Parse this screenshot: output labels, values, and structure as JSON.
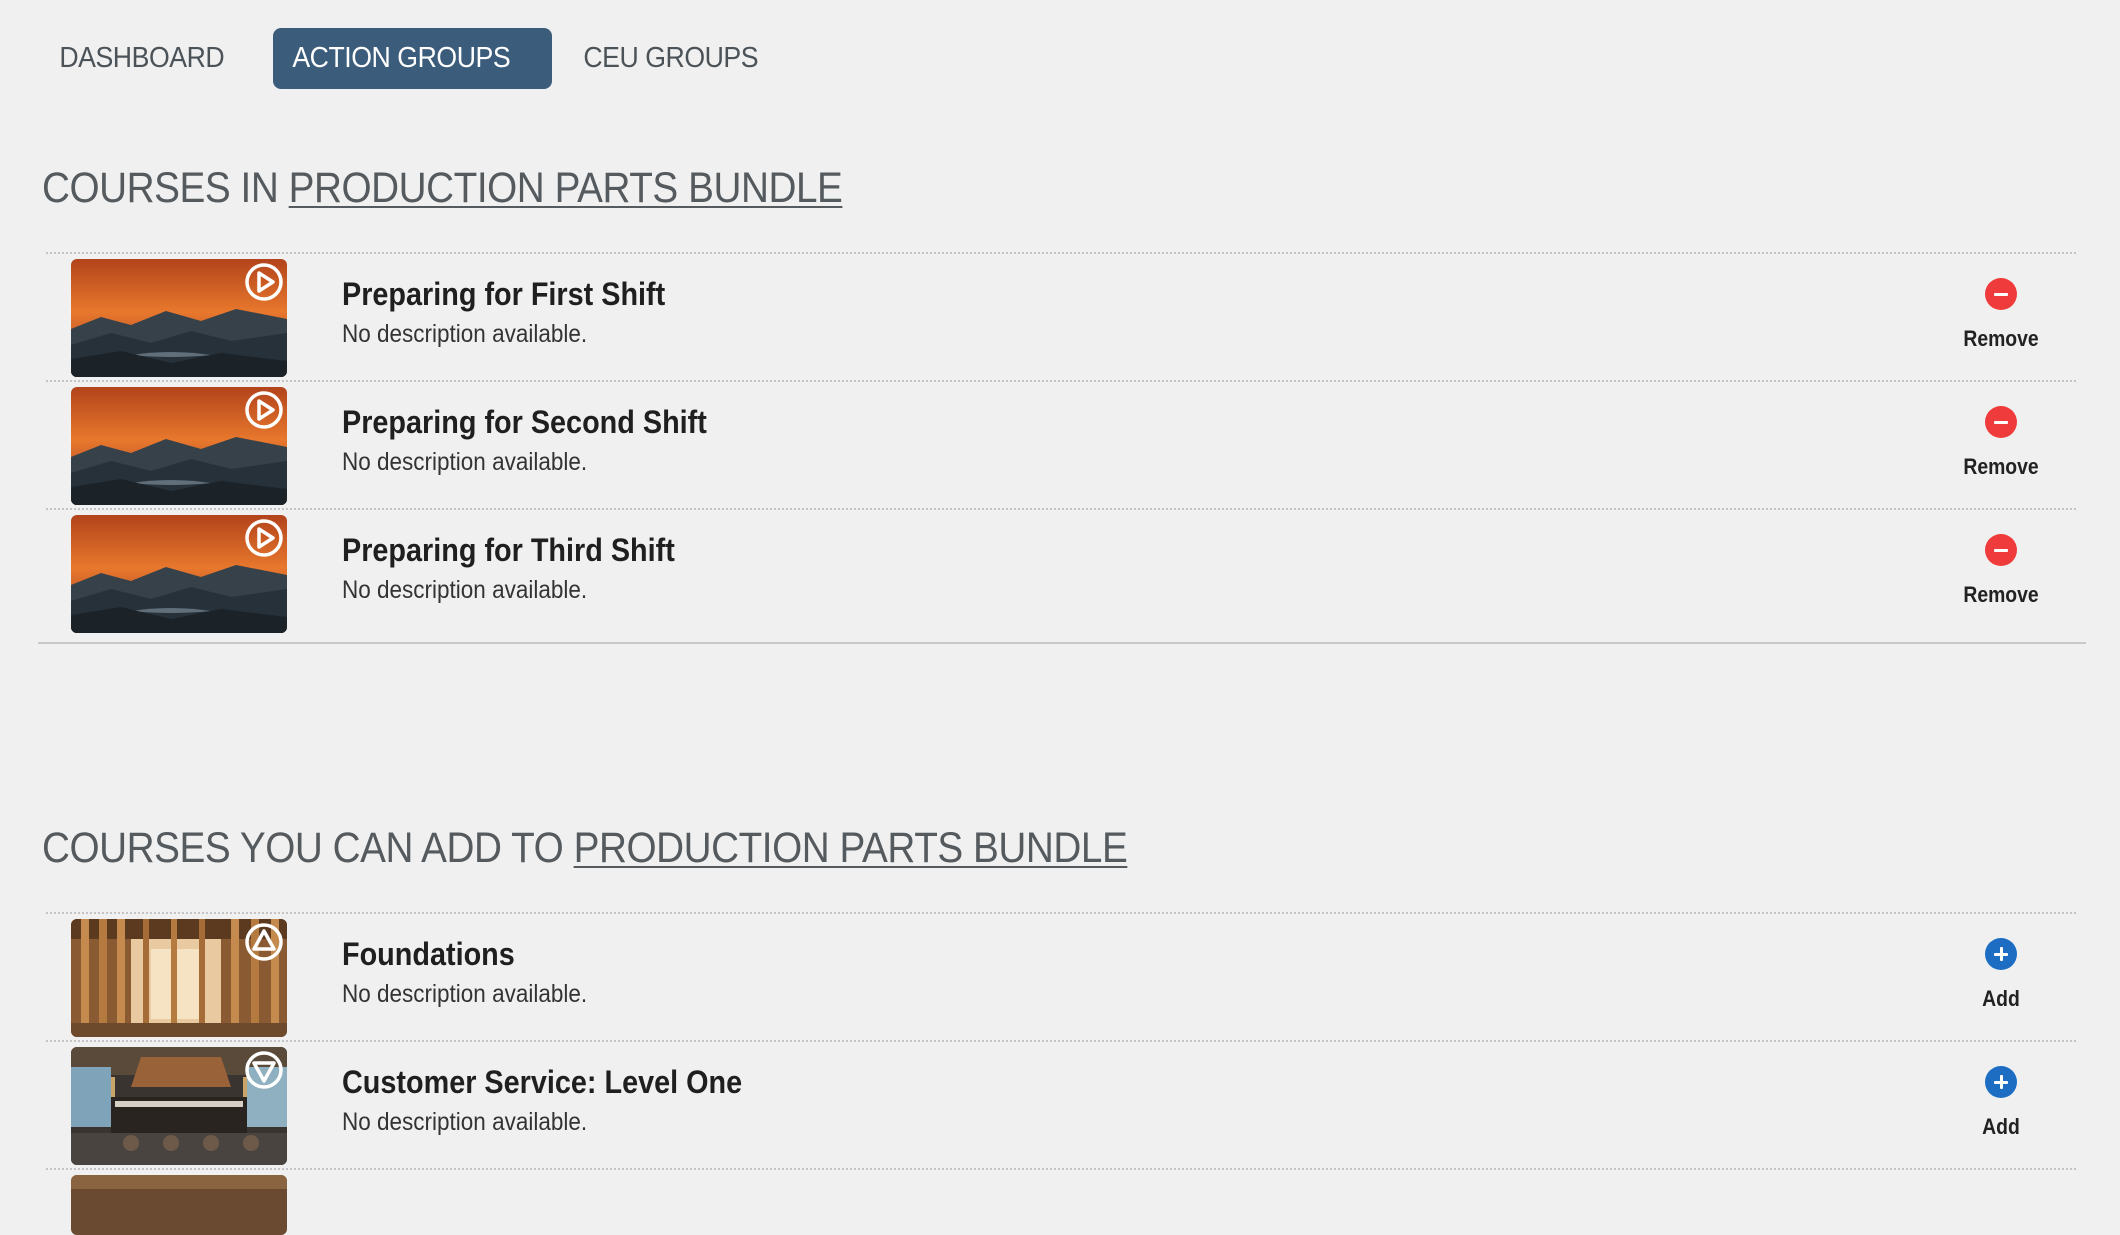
{
  "nav": {
    "tabs": [
      {
        "label": "DASHBOARD",
        "active": false
      },
      {
        "label": "ACTION GROUPS",
        "active": true
      },
      {
        "label": "CEU GROUPS",
        "active": false
      }
    ]
  },
  "bundle_name": "PRODUCTION PARTS BUNDLE",
  "in_section": {
    "prefix": "COURSES IN ",
    "courses": [
      {
        "title": "Preparing for First Shift",
        "description": "No description available.",
        "action": "Remove",
        "thumb": "sunset-mountains",
        "type_icon": "play-icon"
      },
      {
        "title": "Preparing for Second Shift",
        "description": "No description available.",
        "action": "Remove",
        "thumb": "sunset-mountains",
        "type_icon": "play-icon"
      },
      {
        "title": "Preparing for Third Shift",
        "description": "No description available.",
        "action": "Remove",
        "thumb": "sunset-mountains",
        "type_icon": "play-icon"
      }
    ]
  },
  "add_section": {
    "prefix": "COURSES YOU CAN ADD TO ",
    "courses": [
      {
        "title": "Foundations",
        "description": "No description available.",
        "action": "Add",
        "thumb": "construction-framing",
        "type_icon": "triangle-up-icon"
      },
      {
        "title": "Customer Service: Level One",
        "description": "No description available.",
        "action": "Add",
        "thumb": "restaurant-interior",
        "type_icon": "triangle-down-icon"
      }
    ]
  },
  "colors": {
    "active_tab": "#3b5c7a",
    "remove": "#ef3b3b",
    "add": "#1d6ec2",
    "background": "#f0f0f0"
  }
}
